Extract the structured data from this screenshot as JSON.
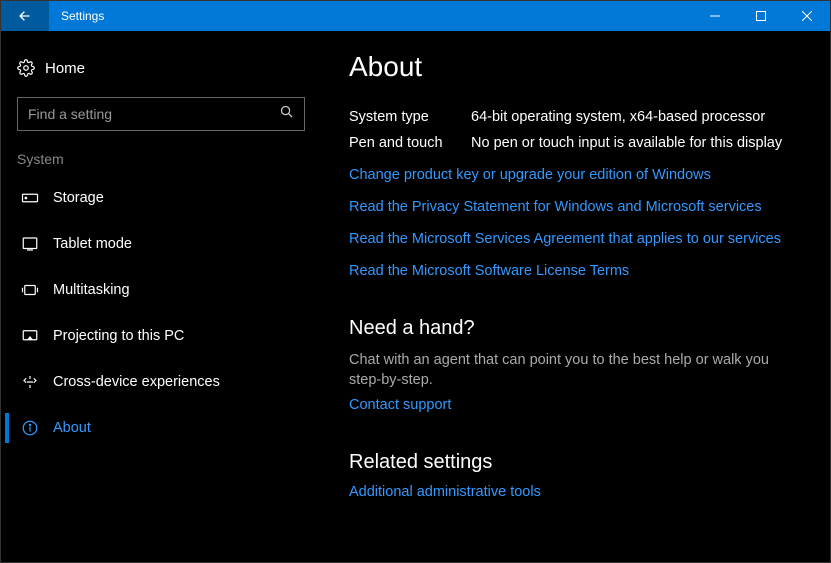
{
  "titlebar": {
    "title": "Settings"
  },
  "sidebar": {
    "home_label": "Home",
    "search_placeholder": "Find a setting",
    "category_label": "System",
    "items": [
      {
        "label": "Storage",
        "icon": "storage-icon"
      },
      {
        "label": "Tablet mode",
        "icon": "tablet-icon"
      },
      {
        "label": "Multitasking",
        "icon": "multitasking-icon"
      },
      {
        "label": "Projecting to this PC",
        "icon": "projecting-icon"
      },
      {
        "label": "Cross-device experiences",
        "icon": "cross-device-icon"
      },
      {
        "label": "About",
        "icon": "info-icon",
        "active": true
      }
    ]
  },
  "main": {
    "title": "About",
    "info": [
      {
        "key": "System type",
        "value": "64-bit operating system, x64-based processor"
      },
      {
        "key": "Pen and touch",
        "value": "No pen or touch input is available for this display"
      }
    ],
    "links": [
      "Change product key or upgrade your edition of Windows",
      "Read the Privacy Statement for Windows and Microsoft services",
      "Read the Microsoft Services Agreement that applies to our services",
      "Read the Microsoft Software License Terms"
    ],
    "help_heading": "Need a hand?",
    "help_body": "Chat with an agent that can point you to the best help or walk you step-by-step.",
    "help_link": "Contact support",
    "related_heading": "Related settings",
    "related_link": "Additional administrative tools"
  }
}
